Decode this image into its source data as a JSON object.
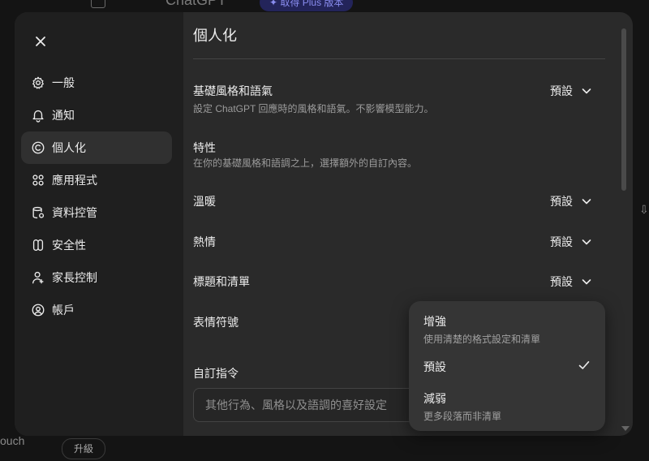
{
  "background": {
    "title": "ChatGPT",
    "upgrade_pill": "✦ 取得 Plus 版本",
    "footer_text": "ouch",
    "footer_button": "升級"
  },
  "sidebar": {
    "items": [
      {
        "label": "一般",
        "icon": "gear-icon"
      },
      {
        "label": "通知",
        "icon": "bell-icon"
      },
      {
        "label": "個人化",
        "icon": "personalization-icon",
        "active": true
      },
      {
        "label": "應用程式",
        "icon": "apps-grid-icon"
      },
      {
        "label": "資料控管",
        "icon": "data-controls-icon"
      },
      {
        "label": "安全性",
        "icon": "shield-icon"
      },
      {
        "label": "家長控制",
        "icon": "parental-user-icon"
      },
      {
        "label": "帳戶",
        "icon": "account-icon"
      }
    ]
  },
  "main": {
    "title": "個人化",
    "base_style": {
      "label": "基礎風格和語氣",
      "description": "設定 ChatGPT 回應時的風格和語氣。不影響模型能力。",
      "value": "預設"
    },
    "traits": {
      "label": "特性",
      "description": "在你的基礎風格和語調之上，選擇額外的自訂內容。"
    },
    "warmth": {
      "label": "溫暖",
      "value": "預設"
    },
    "enthusiasm": {
      "label": "熱情",
      "value": "預設"
    },
    "headers_lists": {
      "label": "標題和清單",
      "value": "預設"
    },
    "emoji": {
      "label": "表情符號"
    },
    "custom_instructions": {
      "label": "自訂指令",
      "placeholder": "其他行為、風格以及語調的喜好設定"
    }
  },
  "dropdown": {
    "options": [
      {
        "title": "增強",
        "description": "使用清楚的格式設定和清單",
        "selected": false
      },
      {
        "title": "預設",
        "description": "",
        "selected": true
      },
      {
        "title": "減弱",
        "description": "更多段落而非清單",
        "selected": false
      }
    ]
  },
  "colors": {
    "modal_bg": "#2a2a2a",
    "sidebar_bg": "#1f1f1f",
    "active_item_bg": "#303030",
    "dropdown_bg": "#353535",
    "text_primary": "#ececec",
    "text_secondary": "#9b9b9b"
  }
}
